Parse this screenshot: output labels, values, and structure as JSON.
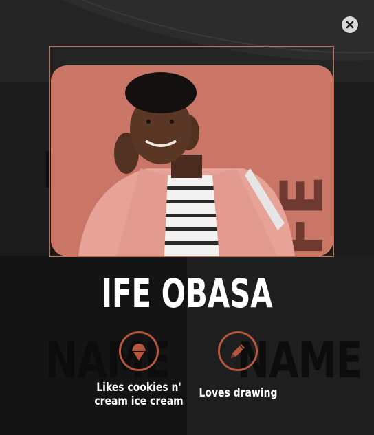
{
  "profile": {
    "name": "IFE OBASA",
    "photo_alt": "IFE"
  },
  "facts": [
    {
      "label": "Likes cookies n' cream ice cream",
      "icon": "ice-cream-icon"
    },
    {
      "label": "Loves drawing",
      "icon": "pencil-icon"
    }
  ],
  "background": {
    "ghost_text": "NAME"
  },
  "colors": {
    "accent": "#b5563d",
    "frame": "#c8683e",
    "photo_bg": "#c97667",
    "text": "#ffffff",
    "background": "#1b1b1b"
  }
}
